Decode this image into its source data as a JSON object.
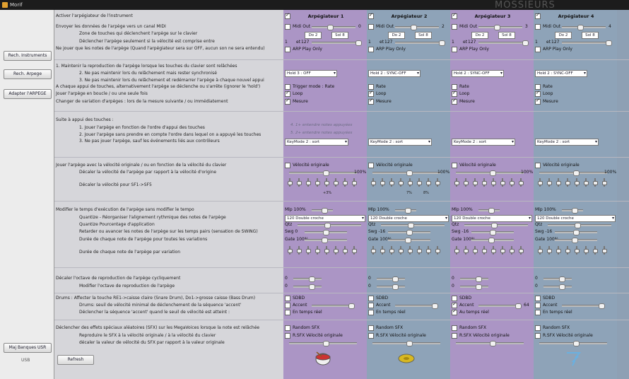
{
  "window": {
    "title": "Morif",
    "watermark": "MOSSIEURS"
  },
  "sidebar": {
    "buttons": [
      "Rech. Instruments",
      "Rech. Arpege",
      "Adapter l'ARPEGE",
      "Maj Banques USR"
    ],
    "status": "USB"
  },
  "refresh_label": "Refresh",
  "rows": {
    "activate": "Activer l'arpégiateur de l'instrument",
    "send_midi": "Envoyer les données de l'arpège vers un canal MIDI",
    "zone": "Zone de touches qui déclenchent l'arpège sur le clavier",
    "velocity": "Déclencher l'arpège seulement si la vélocité est comprise entre",
    "play_only": "Ne jouer que les notes de l'arpège (Quand l'arpégiateur sera sur OFF, aucun son ne sera entendu)",
    "hold1": "1. Maintenir la reproduction de l'arpège lorsque les touches du clavier sont relâchées",
    "hold2": "2. Ne pas maintenir lors du relâchement mais rester synchronisé",
    "hold3": "3. Ne pas maintenir lors du relâchement et redémarrer l'arpège à chaque nouvel appui",
    "trigger": "A chaque appui de touches, alternativement l'arpège se déclenche ou s'arrête  (ignorer le 'hold')",
    "loop": "Jouer l'arpège  en boucle / ou une seule fois",
    "measure": "Changer de variation d'arpèges : lors de la mesure suivante / ou immédiatement",
    "suite_title": "Suite à appui des touches :",
    "suite1": "1. Jouer l'arpège en fonction de l'ordre d'appui des touches",
    "suite2": "2. Jouer l'arpège sans prendre en compte l'ordre dans lequel on a appuyé les touches",
    "suite3": "3. Ne pas jouer l'arpège, sauf les événements liés aux contrôleurs",
    "vel_orig": "Jouer l'arpège avec la vélocité originale / ou en fonction de la vélocité du clavier",
    "vel_dec": "Décaler la vélocité de l'arpège par rapport à la vélocité d'origine",
    "vel_sf": "Décaler la vélocité pour SF1->SF5",
    "tempo": "Modifier le temps d'exécution de l'arpège sans modifier le tempo",
    "quant": "Quantize - Réorganiser l'alignement rythmique des notes de l'arpège",
    "quant2": "Quantize   Pourcentage d'application",
    "swing": "Retarder ou avancer les notes de l'arpège sur les temps pairs (sensation de SWING)",
    "gate": "Durée de chaque note de l'arpège pour toutes les variations",
    "gatevar": "Durée de chaque note de l'arpège par variation",
    "octave": "Décaler l'octave de reproduction de l'arpège cycliquement",
    "octave2": "Modifier l'octave de reproduction de l'arpège",
    "drums": "Drums : Affecter la touche RE1->caisse claire (Snare Drum), Do1->grosse caisse (Bass Drum)",
    "drums2": "Drums: seuil de vélocité minimal de déclenchement de la séquence 'accent'",
    "drums3": "Déclencher la séquence 'accent' quand le seuil de vélocité est atteint :",
    "sfx": "Déclencher des effets spéciaux aléatoires (SFX) sur les MegaVoices lorsque la note est relâchée",
    "sfx2": "Reproduire le SFX à la vélocité originale / à la vélocité du clavier",
    "sfx3": "décaler la valeur de vélocité du SFX par rapport à la valeur originale"
  },
  "arps": [
    {
      "name": "Arpégiateur 1",
      "color": "purple",
      "active": true,
      "midi_val": "0",
      "zone": [
        "Do 2",
        "Sol 8"
      ],
      "vel": [
        "1",
        "127"
      ],
      "play_only": "ARP Play Only",
      "hold": "Hold 3 : OFF",
      "trigger": "Trigger mode : Rate",
      "keymode": "KeyMode 2 : sort",
      "hint1": "4. 1+ entendre notes appuyées",
      "hint2": "5. 2+ entendre notes appuyées",
      "vel_pct": "100%",
      "sf_pct": [
        "+3%"
      ],
      "mlp": "Mlp 100%",
      "quant": "120 Double croche",
      "qtz": "Qtz",
      "swg": "Swg 0",
      "gate": "Gate 100%",
      "sfx_vel": "R.SFX Vélocité originale",
      "accent_val": "",
      "rt": "En temps réel",
      "loop": true,
      "measure": true,
      "rand": "Random SFX",
      "sdbd": "SDBD",
      "accent": "Accent",
      "icon": "drum-icon"
    },
    {
      "name": "Arpégiateur 2",
      "color": "blue",
      "active": true,
      "midi_val": "2",
      "zone": [
        "Do 2",
        "Sol 8"
      ],
      "vel": [
        "1",
        "127"
      ],
      "play_only": "ARP Play Only",
      "hold": "Hold 2 : SYNC-OFF",
      "trigger": "Rate",
      "keymode": "KeyMode 2 : sort",
      "hint1": "",
      "hint2": "",
      "vel_pct": "100%",
      "sf_pct": [
        "7%",
        "8%"
      ],
      "mlp": "Mlp 100%",
      "quant": "120 Double croche",
      "qtz": "Qtz",
      "swg": "Swg -16",
      "gate": "Gate 100%",
      "sfx_vel": "R.SFX Vélocité originale",
      "accent_val": "",
      "rt": "En temps réel",
      "loop": true,
      "measure": true,
      "rand": "Random SFX",
      "sdbd": "SDBD",
      "accent": "Accent",
      "icon": "cymbal-icon"
    },
    {
      "name": "Arpégiateur 3",
      "color": "purple",
      "active": true,
      "midi_val": "3",
      "zone": [
        "Do 2",
        "Sol 8"
      ],
      "vel": [
        "1",
        "127"
      ],
      "play_only": "ARP Play Only",
      "hold": "Hold 2 : SYNC-OFF",
      "trigger": "Rate",
      "keymode": "KeyMode 2 : sort",
      "hint1": "",
      "hint2": "",
      "vel_pct": "100%",
      "sf_pct": [],
      "mlp": "Mlp 100%",
      "quant": "120 Double croche",
      "qtz": "Qtz",
      "swg": "Swg -16",
      "gate": "Gate 100%",
      "sfx_vel": "R.SFX Vélocité originale",
      "accent_val": "64",
      "rt": "Au temps réel",
      "loop": true,
      "measure": true,
      "rand": "Random SFX",
      "sdbd": "SDBD",
      "accent": "Accent",
      "icon": "none"
    },
    {
      "name": "Arpégiateur 4",
      "color": "blue",
      "active": true,
      "midi_val": "4",
      "zone": [
        "Do 2",
        "Sol 8"
      ],
      "vel": [
        "1",
        "127"
      ],
      "play_only": "ARP Play Only",
      "hold": "Hold 2 : SYNC-OFF",
      "trigger": "Rate",
      "keymode": "KeyMode 2 : sort",
      "hint1": "",
      "hint2": "",
      "vel_pct": "100%",
      "sf_pct": [],
      "mlp": "Mlp 100%",
      "quant": "120 Double croche",
      "qtz": "Qtz",
      "swg": "Swg -16",
      "gate": "Gate 100%",
      "sfx_vel": "R.SFX Vélocité originale",
      "accent_val": "",
      "rt": "En temps réel",
      "loop": true,
      "measure": true,
      "rand": "Random SFX",
      "sdbd": "SDBD",
      "accent": "Accent",
      "icon": "tornado-icon"
    }
  ],
  "common": {
    "midi_out": "Midi Out",
    "et": "et",
    "rate": "Rate",
    "loop": "Loop",
    "mesure": "Mesure",
    "vel_orig": "Vélocité originale",
    "zero": "0"
  }
}
